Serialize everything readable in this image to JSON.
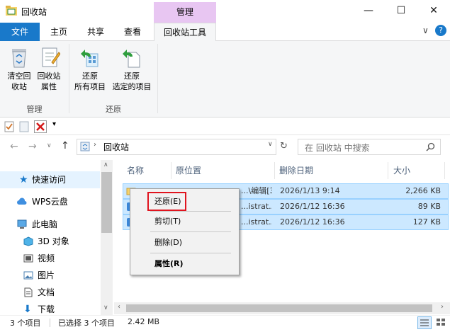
{
  "window": {
    "title": "回收站",
    "context_group": "管理",
    "minimize": "—",
    "maximize": "☐",
    "close": "✕",
    "chevron": "∨",
    "help": "?"
  },
  "ribbon": {
    "tabs": [
      "文件",
      "主页",
      "共享",
      "查看",
      "回收站工具"
    ],
    "empty_bin_label_1": "清空回",
    "empty_bin_label_2": "收站",
    "props_label_1": "回收站",
    "props_label_2": "属性",
    "restore_all_1": "还原",
    "restore_all_2": "所有项目",
    "restore_sel_1": "还原",
    "restore_sel_2": "选定的项目",
    "group_manage": "管理",
    "group_restore": "还原"
  },
  "address": {
    "path": "回收站",
    "search_placeholder": "在 回收站 中搜索"
  },
  "nav": {
    "items": [
      "快速访问",
      "WPS云盘",
      "此电脑",
      "3D 对象",
      "视频",
      "图片",
      "文档",
      "下载"
    ]
  },
  "columns": [
    "名称",
    "原位置",
    "删除日期",
    "大小"
  ],
  "files": [
    {
      "location": "...\\编辑[3\\1工作详情...",
      "date": "2026/1/13 9:14",
      "size": "2,266 KB"
    },
    {
      "location": "...istrat...",
      "date": "2026/1/12 16:36",
      "size": "89 KB"
    },
    {
      "location": "...istrat...",
      "date": "2026/1/12 16:36",
      "size": "127 KB"
    }
  ],
  "context_menu": {
    "restore": "还原(E)",
    "cut": "剪切(T)",
    "delete": "删除(D)",
    "properties": "属性(R)"
  },
  "status": {
    "count": "3 个项目",
    "selected": "已选择 3 个项目",
    "size": "2.42 MB"
  },
  "colors": {
    "file_tab": "#1979ca",
    "context_group": "#e8c6f2",
    "selection": "#cce8ff",
    "highlight_box": "#e0141e"
  }
}
